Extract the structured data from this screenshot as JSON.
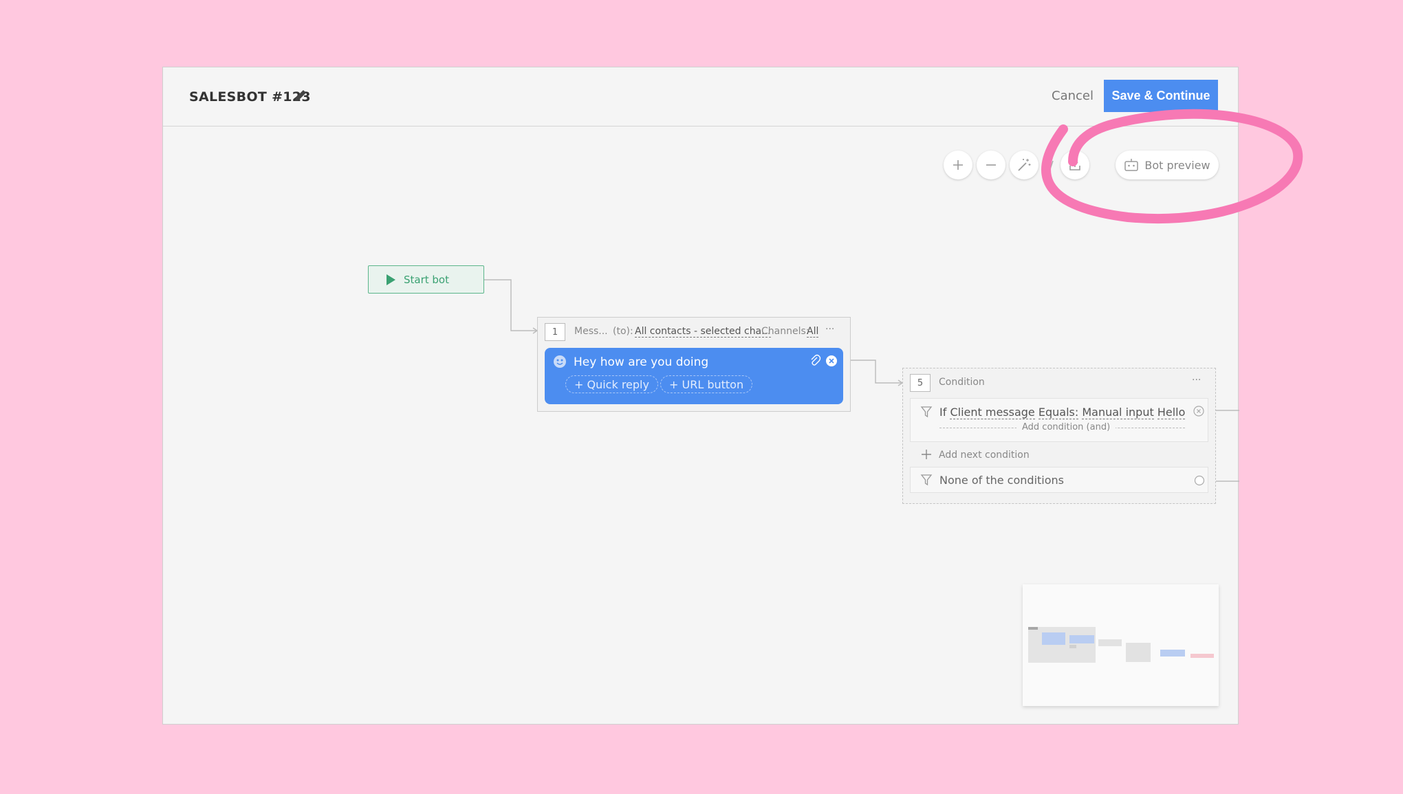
{
  "header": {
    "title": "SALESBOT #123",
    "cancel_label": "Cancel",
    "save_label": "Save & Continue"
  },
  "toolbar": {
    "zoom_in_icon": "plus-icon",
    "zoom_out_icon": "minus-icon",
    "auto_arrange_icon": "magic-wand-icon",
    "export_icon": "upload-icon",
    "bot_preview_label": "Bot preview"
  },
  "start_node": {
    "label": "Start bot"
  },
  "message_node": {
    "number": "1",
    "type_label": "Mess...",
    "to_label": "(to):",
    "recipients": "All contacts - selected cha...",
    "channels_label": "Channels:",
    "channels_value": "All",
    "more": "···",
    "message_text": "Hey how are you doing",
    "quick_reply_label": "+ Quick reply",
    "url_button_label": "+ URL button"
  },
  "condition_node": {
    "number": "5",
    "title": "Condition",
    "more": "···",
    "rule_if": "If",
    "rule_field": "Client message",
    "rule_operator": "Equals:",
    "rule_source": "Manual input",
    "rule_value": "Hello",
    "add_condition_and": "Add condition (and)",
    "add_next_condition": "Add next condition",
    "none_of_conditions": "None of the conditions"
  },
  "colors": {
    "accent": "#4c8df0",
    "start_green": "#3aa172",
    "background_pink": "#ffc8df",
    "annotation_pink": "#f779b4"
  }
}
